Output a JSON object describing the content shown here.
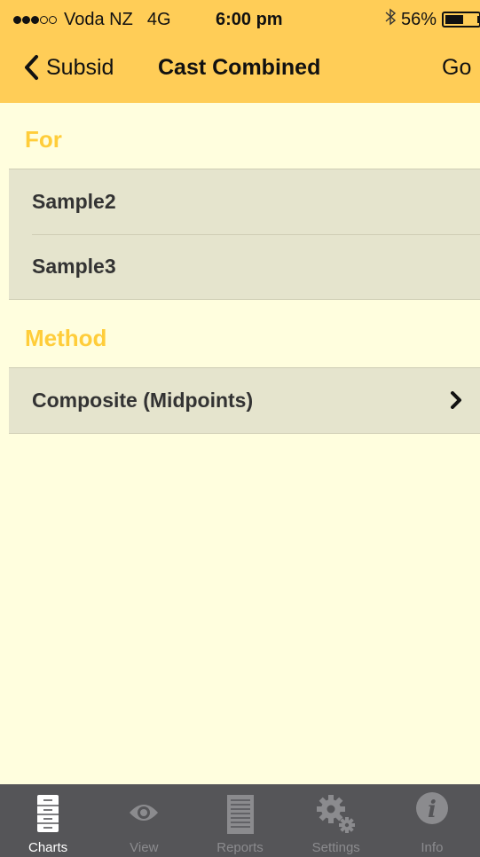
{
  "status_bar": {
    "signal_full": 3,
    "signal_total": 5,
    "carrier": "Voda NZ",
    "network": "4G",
    "time": "6:00 pm",
    "bluetooth_icon": "bluetooth-icon",
    "battery_text": "56%",
    "battery_level": 0.56
  },
  "nav": {
    "back_label": "Subsid",
    "title": "Cast Combined",
    "go_label": "Go"
  },
  "sections": {
    "for": {
      "header": "For",
      "items": [
        "Sample2",
        "Sample3"
      ]
    },
    "method": {
      "header": "Method",
      "value": "Composite (Midpoints)"
    }
  },
  "tabs": [
    {
      "label": "Charts",
      "icon": "cabinet-icon",
      "active": true
    },
    {
      "label": "View",
      "icon": "eye-icon",
      "active": false
    },
    {
      "label": "Reports",
      "icon": "document-icon",
      "active": false
    },
    {
      "label": "Settings",
      "icon": "gears-icon",
      "active": false
    },
    {
      "label": "Info",
      "icon": "info-icon",
      "active": false
    }
  ],
  "colors": {
    "accent": "#ffcd57",
    "section_header": "#ffcd3a",
    "background": "#fffede",
    "row_background": "#e5e4cd",
    "tab_bar": "#555558"
  }
}
